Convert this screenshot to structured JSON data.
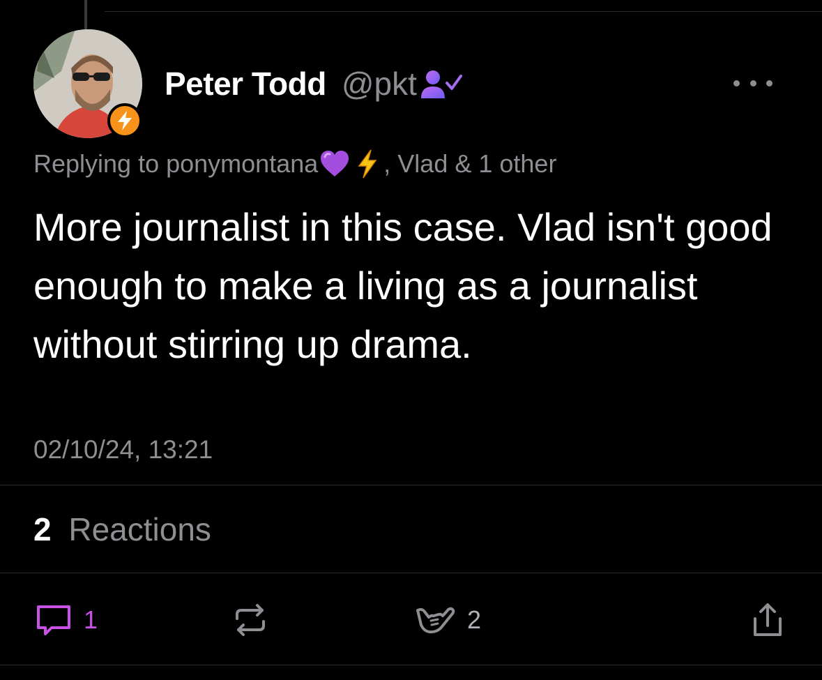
{
  "post": {
    "author": {
      "display_name": "Peter Todd",
      "handle": "@pkt",
      "avatar_icon": "profile-photo",
      "badge_icon": "lightning-bolt-icon",
      "verified_icon": "user-check-icon"
    },
    "reply_context": {
      "prefix": "Replying to ",
      "target": "ponymontana",
      "target_emojis": [
        "purple-heart-icon",
        "high-voltage-icon"
      ],
      "suffix": ", Vlad & 1 other"
    },
    "text": "More journalist in this case. Vlad isn't good enough to make a living as a journalist without stirring up drama.",
    "timestamp": "02/10/24, 13:21"
  },
  "reactions": {
    "count": "2",
    "label": "Reactions"
  },
  "actions": {
    "reply_count": "1",
    "zap_count": "2"
  },
  "colors": {
    "background": "#000000",
    "accent_purple": "#c851e6",
    "secondary_text": "#8e8e93",
    "zap_orange": "#f7931a"
  }
}
